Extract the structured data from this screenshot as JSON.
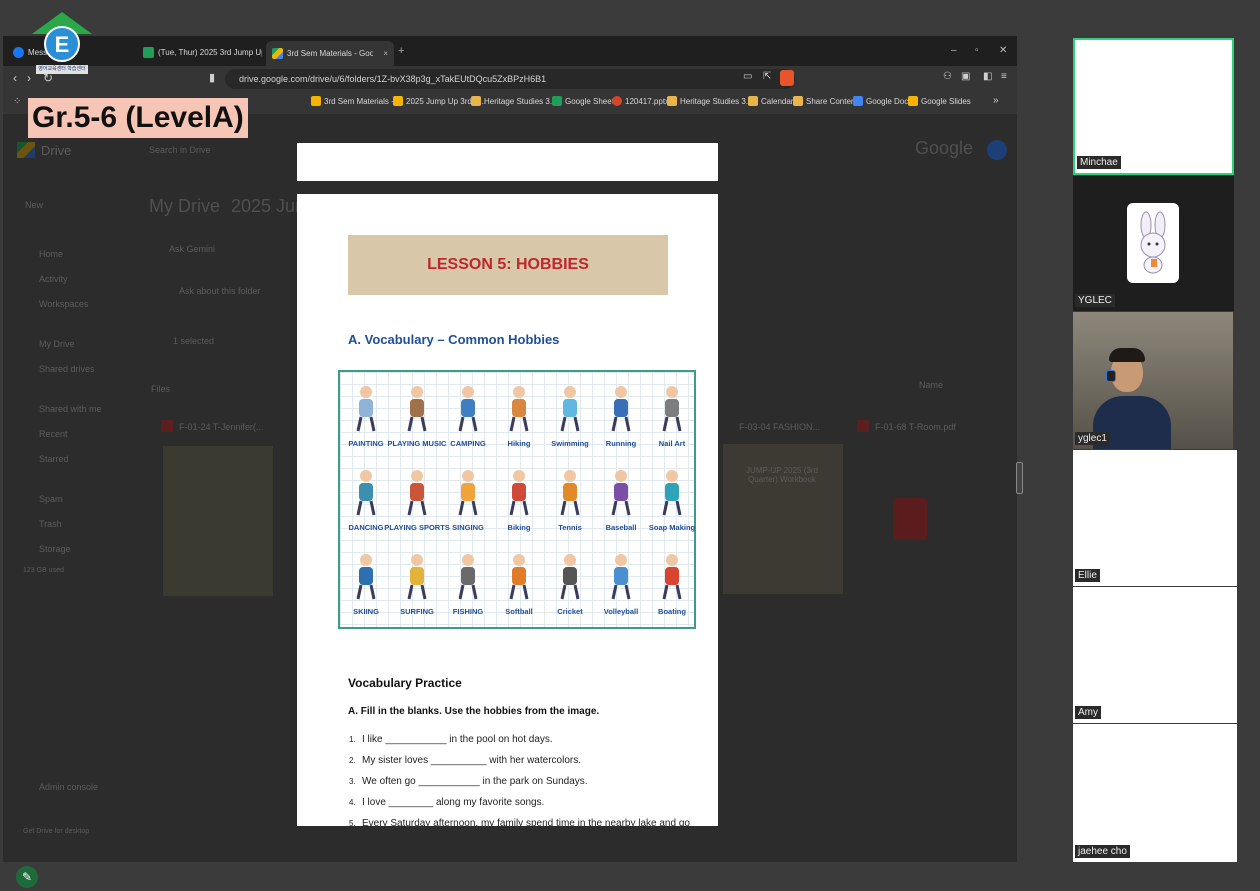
{
  "overlay": {
    "logo_caption": "영어교육센터 학습센터",
    "level_label": "Gr.5-6 (LevelA)"
  },
  "browser": {
    "tabs": [
      {
        "label": "Messenger",
        "icon_color": "#1877f2",
        "active": false
      },
      {
        "label": "(Tue, Thur) 2025 3rd Jump Up Zoom",
        "icon_color": "#1e9e57",
        "active": false
      },
      {
        "label": "3rd Sem Materials - Google Drive",
        "icon_color": "#f4b400",
        "active": true
      }
    ],
    "tab_close": "×",
    "new_tab": "+",
    "window_controls": [
      "–",
      "▫",
      "✕"
    ],
    "url": "drive.google.com/drive/u/6/folders/1Z-bvX38p3g_xTakEUtDQcu5ZxBPzH6B1",
    "bookmarks": [
      {
        "label": "3rd Sem Materials -...",
        "icon_color": "#f4b400"
      },
      {
        "label": "2025 Jump Up 3rd S...",
        "icon_color": "#f4b400"
      },
      {
        "label": "Heritage Studies 3...",
        "icon_color": "#e8b54a"
      },
      {
        "label": "Google Sheets",
        "icon_color": "#1e9e57"
      },
      {
        "label": "120417.pptx",
        "icon_color": "#d24726"
      },
      {
        "label": "Heritage Studies 3...",
        "icon_color": "#e8b54a"
      },
      {
        "label": "Calendar",
        "icon_color": "#e8b54a"
      },
      {
        "label": "Share Content",
        "icon_color": "#e8b54a"
      },
      {
        "label": "Google Docs",
        "icon_color": "#4285f4"
      },
      {
        "label": "Google Slides",
        "icon_color": "#f4b400"
      }
    ],
    "bookmarks_more": "»"
  },
  "drive": {
    "app_name": "Drive",
    "search_placeholder": "Search in Drive",
    "new_label": "New",
    "nav": [
      "Home",
      "Activity",
      "Workspaces",
      "My Drive",
      "Shared drives",
      "Shared with me",
      "Recent",
      "Starred",
      "Spam",
      "Trash",
      "Storage"
    ],
    "storage_used": "123 GB used",
    "breadcrumb_root": "My Drive",
    "breadcrumb_sub": "2025 Jump",
    "ask_gemini": "Ask Gemini",
    "ask_folder": "Ask about this folder",
    "selected": "1 selected",
    "files_heading": "Files",
    "file_left": "F-01-24 T-Jennifer(...",
    "file_mid": "F-03-04 FASHION...",
    "file_right": "F-01-68 T-Room.pdf",
    "sort_label": "Name",
    "admin_console": "Admin console",
    "get_more": "Get Drive for desktop",
    "thumb_caption": "JUMP-UP 2025 (3rd Quarter) Workbook",
    "google_word": "Google"
  },
  "document": {
    "lesson_title": "LESSON 5: HOBBIES",
    "vocab_heading": "A. Vocabulary – Common Hobbies",
    "hobbies": [
      {
        "label": "PAINTING",
        "color": "#8fb3d9"
      },
      {
        "label": "PLAYING MUSIC",
        "color": "#a0704a"
      },
      {
        "label": "CAMPING",
        "color": "#3f7fc1"
      },
      {
        "label": "Hiking",
        "color": "#d9863f"
      },
      {
        "label": "Swimming",
        "color": "#5fb8e0"
      },
      {
        "label": "Running",
        "color": "#3a6fb5"
      },
      {
        "label": "Nail Art",
        "color": "#7d7d7d"
      },
      {
        "label": "DANCING",
        "color": "#3d8fb0"
      },
      {
        "label": "PLAYING SPORTS",
        "color": "#c9553a"
      },
      {
        "label": "SINGING",
        "color": "#f0a33a"
      },
      {
        "label": "Biking",
        "color": "#d04a3a"
      },
      {
        "label": "Tennis",
        "color": "#e08a2a"
      },
      {
        "label": "Baseball",
        "color": "#7a4fa5"
      },
      {
        "label": "Soap Making",
        "color": "#2ea3b8"
      },
      {
        "label": "SKIING",
        "color": "#2e6fb0"
      },
      {
        "label": "SURFING",
        "color": "#e2b23a"
      },
      {
        "label": "FISHING",
        "color": "#6a6a6a"
      },
      {
        "label": "Softball",
        "color": "#e07b2a"
      },
      {
        "label": "Cricket",
        "color": "#555555"
      },
      {
        "label": "Volleyball",
        "color": "#4a8fd0"
      },
      {
        "label": "Boating",
        "color": "#d9432f"
      }
    ],
    "practice_heading": "Vocabulary Practice",
    "instruction": "A. Fill in the blanks. Use the hobbies from the image.",
    "questions": [
      {
        "n": "1.",
        "text": "I like ___________ in the pool on hot days."
      },
      {
        "n": "2.",
        "text": "My sister loves __________ with her watercolors."
      },
      {
        "n": "3.",
        "text": "We often go ___________ in the park on Sundays."
      },
      {
        "n": "4.",
        "text": "I love ________ along my favorite songs."
      },
      {
        "n": "5.",
        "text": "Every Saturday afternoon, my family spend time in the nearby lake and go"
      }
    ]
  },
  "participants": [
    {
      "name": "Minchae",
      "bg": "#ffffff",
      "highlight": true
    },
    {
      "name": "YGLEC",
      "bg": "#1e1e1e",
      "avatar": "bunny"
    },
    {
      "name": "yglec1",
      "bg": "#6c675d",
      "video": true
    },
    {
      "name": "Ellie",
      "bg": "#ffffff"
    },
    {
      "name": "Amy",
      "bg": "#ffffff"
    },
    {
      "name": "jaehee cho",
      "bg": "#ffffff"
    }
  ]
}
